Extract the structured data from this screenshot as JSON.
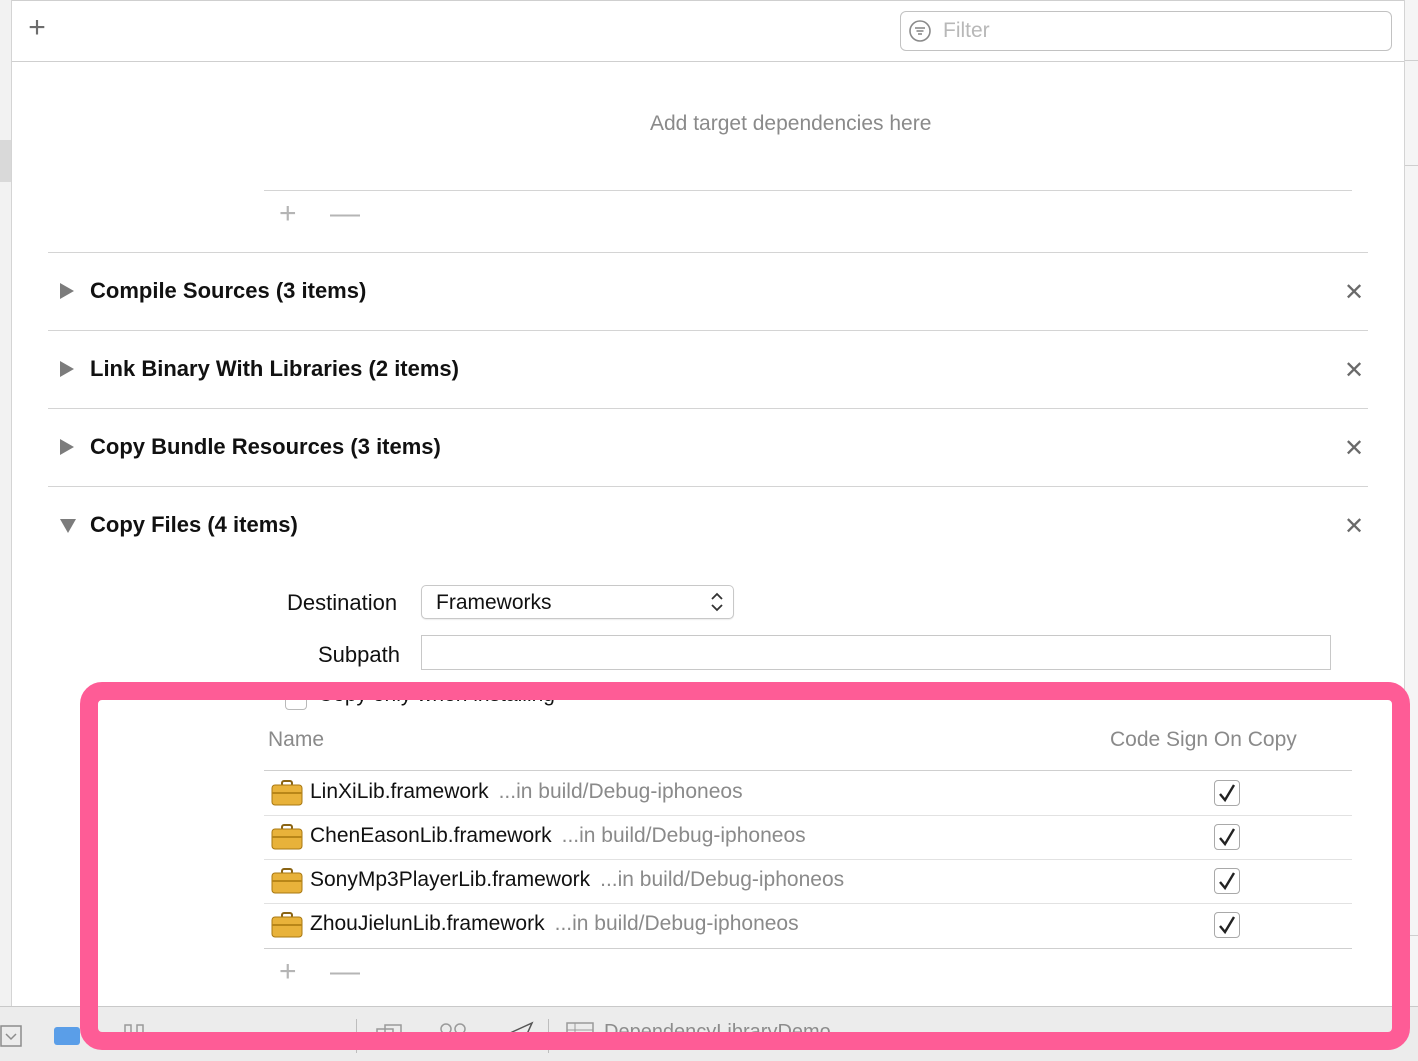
{
  "filter": {
    "placeholder": "Filter"
  },
  "dependencies": {
    "empty_text": "Add target dependencies here"
  },
  "controls": {
    "plus": "+",
    "minus": "—",
    "close": "✕"
  },
  "phases": [
    {
      "title": "Compile Sources (3 items)",
      "expanded": false
    },
    {
      "title": "Link Binary With Libraries (2 items)",
      "expanded": false
    },
    {
      "title": "Copy Bundle Resources (3 items)",
      "expanded": false
    },
    {
      "title": "Copy Files (4 items)",
      "expanded": true
    }
  ],
  "copy_files": {
    "destination_label": "Destination",
    "destination_value": "Frameworks",
    "subpath_label": "Subpath",
    "subpath_value": "",
    "copy_only_label": "Copy only when installing",
    "columns": {
      "name": "Name",
      "code_sign": "Code Sign On Copy"
    },
    "files": [
      {
        "name": "LinXiLib.framework",
        "path": "...in build/Debug-iphoneos",
        "code_sign": true
      },
      {
        "name": "ChenEasonLib.framework",
        "path": "...in build/Debug-iphoneos",
        "code_sign": true
      },
      {
        "name": "SonyMp3PlayerLib.framework",
        "path": "...in build/Debug-iphoneos",
        "code_sign": true
      },
      {
        "name": "ZhouJielunLib.framework",
        "path": "...in build/Debug-iphoneos",
        "code_sign": true
      }
    ]
  },
  "bottom_bar": {
    "scheme_text": "DependencyLibraryDemo"
  },
  "colors": {
    "highlight": "#fe5c96",
    "icon_gold": "#e8b23a"
  }
}
